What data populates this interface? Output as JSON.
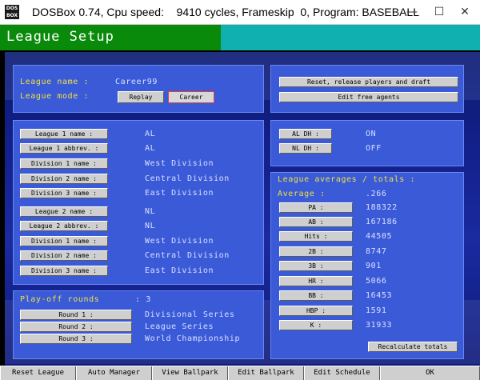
{
  "window": {
    "title": "DOSBox 0.74, Cpu speed:    9410 cycles, Frameskip  0, Program: BASEBALL",
    "icon_text": "DOS BOX",
    "minimize": "—",
    "maximize": "☐",
    "close": "✕"
  },
  "header": {
    "title": "League Setup"
  },
  "league": {
    "name_label": "League name  :",
    "name_value": "Career99",
    "mode_label": "League mode  :",
    "mode_options": [
      "Replay",
      "Career"
    ],
    "mode_selected": "Career"
  },
  "actions": {
    "reset_release": "Reset, release players and draft",
    "edit_free_agents": "Edit free agents"
  },
  "leagues": [
    {
      "name_btn": "League 1 name :",
      "name_val": "AL",
      "abbrev_btn": "League 1 abbrev. :",
      "abbrev_val": "AL",
      "divisions": [
        {
          "btn": "Division 1 name :",
          "val": "West Division"
        },
        {
          "btn": "Division 2 name :",
          "val": "Central Division"
        },
        {
          "btn": "Division 3 name :",
          "val": "East Division"
        }
      ]
    },
    {
      "name_btn": "League 2 name :",
      "name_val": "NL",
      "abbrev_btn": "League 2 abbrev. :",
      "abbrev_val": "NL",
      "divisions": [
        {
          "btn": "Division 1 name :",
          "val": "West Division"
        },
        {
          "btn": "Division 2 name :",
          "val": "Central Division"
        },
        {
          "btn": "Division 3 name :",
          "val": "East Division"
        }
      ]
    }
  ],
  "dh": [
    {
      "btn": "AL DH :",
      "val": "ON"
    },
    {
      "btn": "NL DH :",
      "val": "OFF"
    }
  ],
  "playoffs": {
    "label": "Play-off rounds",
    "count_text": ": 3",
    "rounds": [
      {
        "btn": "Round 1 :",
        "val": "Divisional Series"
      },
      {
        "btn": "Round 2 :",
        "val": "League Series"
      },
      {
        "btn": "Round 3 :",
        "val": "World Championship"
      }
    ]
  },
  "averages": {
    "title": "League averages / totals :",
    "avg_label": "Average  :",
    "avg_value": ".266",
    "stats": [
      {
        "btn": "PA :",
        "val": "188322"
      },
      {
        "btn": "AB :",
        "val": "167186"
      },
      {
        "btn": "Hits :",
        "val": "44505"
      },
      {
        "btn": "2B :",
        "val": "8747"
      },
      {
        "btn": "3B :",
        "val": "901"
      },
      {
        "btn": "HR :",
        "val": "5066"
      },
      {
        "btn": "BB :",
        "val": "16453"
      },
      {
        "btn": "HBP :",
        "val": "1591"
      },
      {
        "btn": "K :",
        "val": "31933"
      }
    ],
    "recalc": "Recalculate totals"
  },
  "bottom": [
    "Reset League",
    "Auto Manager",
    "View Ballpark",
    "Edit Ballpark",
    "Edit Schedule",
    "OK"
  ],
  "colors": {
    "panel": "#3a5ad8",
    "header_green": "#0a8a0a",
    "header_teal": "#10b0b0",
    "label_yellow": "#f0e040",
    "label_light": "#d8e0ff"
  }
}
